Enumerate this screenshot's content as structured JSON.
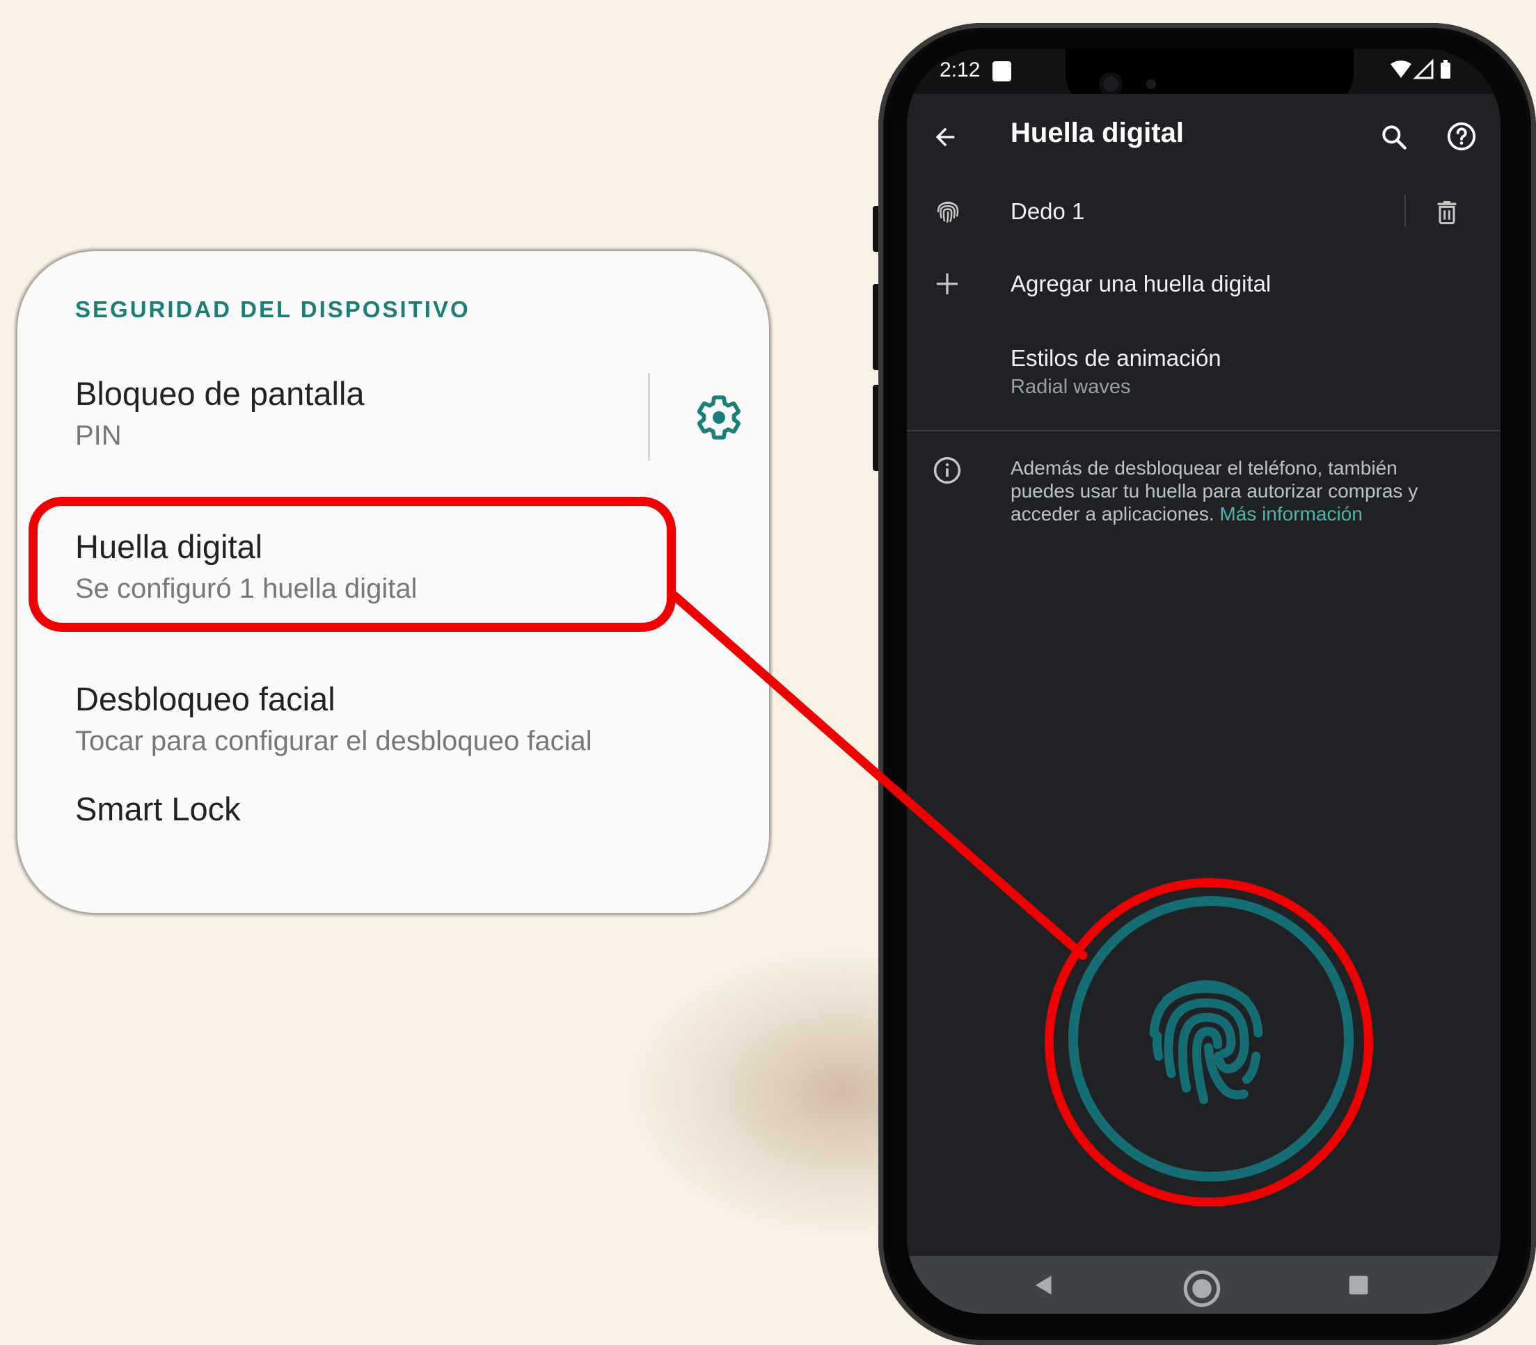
{
  "settings_card": {
    "section_header": "SEGURIDAD DEL DISPOSITIVO",
    "items": [
      {
        "title": "Bloqueo de pantalla",
        "subtitle": "PIN"
      },
      {
        "title": "Huella digital",
        "subtitle": "Se configuró 1 huella digital"
      },
      {
        "title": "Desbloqueo facial",
        "subtitle": "Tocar para configurar el desbloqueo facial"
      },
      {
        "title": "Smart Lock",
        "subtitle": ""
      }
    ],
    "gear_icon": "gear-icon",
    "accent_color": "#1a7f76"
  },
  "phone": {
    "status_bar": {
      "time": "2:12",
      "icons": [
        "notification-square-icon",
        "wifi-icon",
        "signal-icon",
        "battery-icon"
      ]
    },
    "app_bar": {
      "title": "Huella digital",
      "back_icon": "arrow-left-icon",
      "search_icon": "search-icon",
      "help_icon": "help-icon"
    },
    "list": [
      {
        "icon": "fingerprint-icon",
        "label": "Dedo 1",
        "action_icon": "trash-icon"
      },
      {
        "icon": "plus-icon",
        "label": "Agregar una huella digital"
      },
      {
        "label": "Estilos de animación",
        "sublabel": "Radial waves"
      }
    ],
    "info": {
      "icon": "info-icon",
      "text": "Además de desbloquear el teléfono, también puedes usar tu huella para autorizar compras y acceder a aplicaciones.",
      "link": "Más información"
    },
    "nav_bar": [
      "back-triangle-icon",
      "home-circle-icon",
      "recents-square-icon"
    ],
    "accent_color": "#4fb3ab"
  },
  "annotation_color": "#ee0000"
}
